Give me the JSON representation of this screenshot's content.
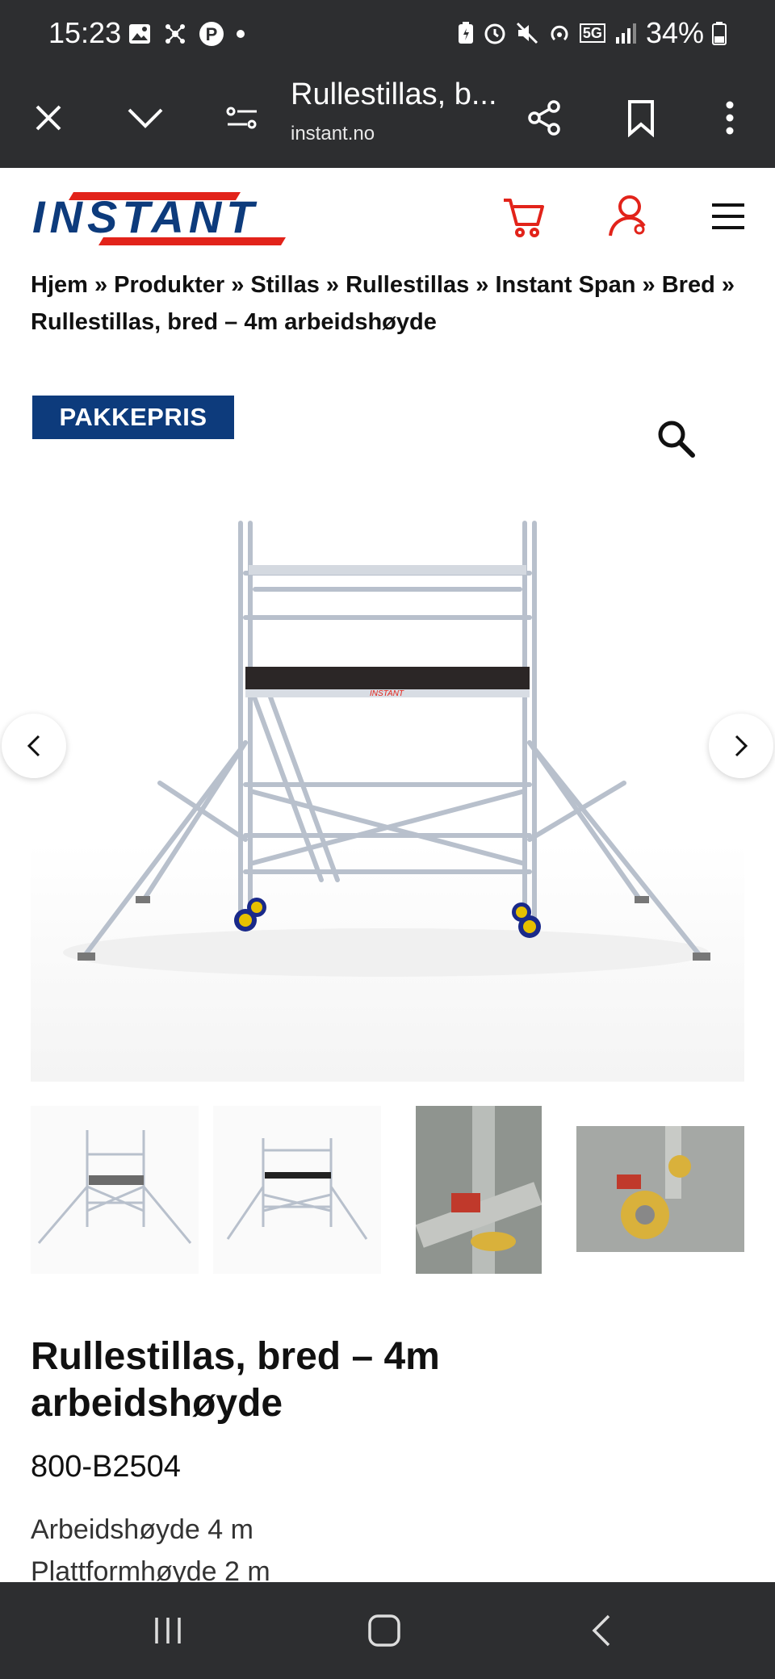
{
  "status_bar": {
    "time": "15:23",
    "battery": "34%",
    "network": "5G"
  },
  "browser": {
    "tab_title": "Rullestillas, b...",
    "url": "instant.no"
  },
  "site": {
    "logo_text": "INSTANT",
    "brand_color": "#e2231a",
    "accent_blue": "#0d3b7c"
  },
  "breadcrumb": {
    "items": [
      "Hjem",
      "Produkter",
      "Stillas",
      "Rullestillas",
      "Instant Span",
      "Bred",
      "Rullestillas, bred – 4m arbeidshøyde"
    ],
    "separator": "»"
  },
  "badge": {
    "label": "PAKKEPRIS"
  },
  "product": {
    "title": "Rullestillas, bred – 4m arbeidshøyde",
    "sku": "800-B2504",
    "specs": [
      "Arbeidshøyde 4 m",
      "Plattformhøyde 2 m"
    ]
  },
  "icons": {
    "close": "close-icon",
    "collapse": "chevron-down-icon",
    "site_settings": "tune-icon",
    "share": "share-icon",
    "bookmark": "bookmark-icon",
    "menu": "more-vert-icon",
    "cart": "cart-icon",
    "account": "user-icon",
    "hamburger": "hamburger-icon",
    "zoom": "search-icon"
  }
}
